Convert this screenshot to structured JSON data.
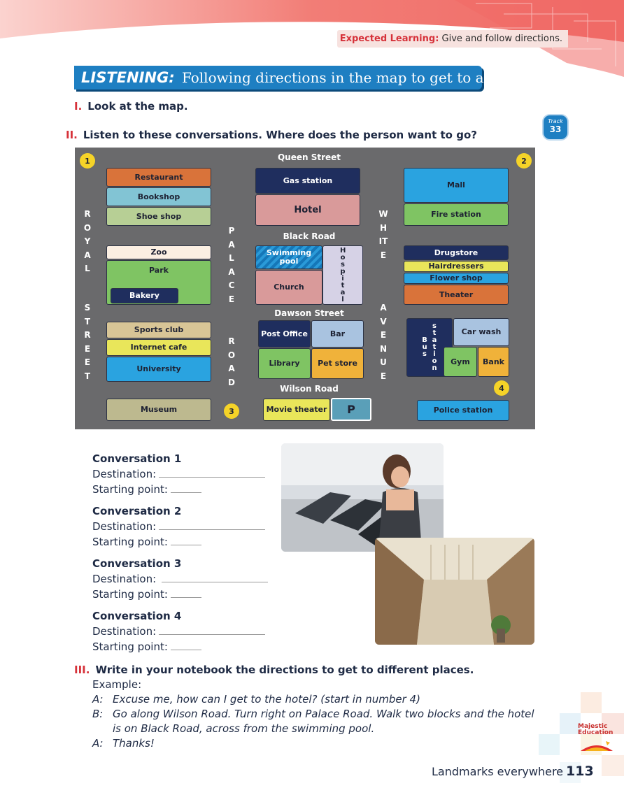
{
  "header": {
    "expected_label": "Expected Learning:",
    "expected_text": "Give and follow directions.",
    "title_keyword": "LISTENING:",
    "title_text": "Following directions in the map to get to a place"
  },
  "instructions": [
    {
      "num": "I.",
      "text": "Look at the map."
    },
    {
      "num": "II.",
      "text": "Listen to these conversations. Where does the person want to go?"
    },
    {
      "num": "III.",
      "text": "Write in your notebook the directions to get to different places."
    }
  ],
  "track": {
    "label": "Track",
    "number": "33"
  },
  "map": {
    "streets": {
      "queen": "Queen Street",
      "black": "Black Road",
      "dawson": "Dawson Street",
      "wilson": "Wilson Road",
      "royal": "ROYAL STREET",
      "royal_1": "ROYAL",
      "royal_2": "STREET",
      "palace": "PALACE ROAD",
      "palace_1": "PALACE",
      "palace_2": "ROAD",
      "white": "WHITE AVENUE",
      "white_1": "WHITE",
      "white_2": "AVENUE"
    },
    "markers": [
      "1",
      "2",
      "3",
      "4"
    ],
    "places": {
      "restaurant": "Restaurant",
      "bookshop": "Bookshop",
      "shoe_shop": "Shoe shop",
      "zoo": "Zoo",
      "park": "Park",
      "bakery": "Bakery",
      "sports_club": "Sports club",
      "internet_cafe": "Internet cafe",
      "university": "University",
      "museum": "Museum",
      "gas_station": "Gas station",
      "hotel": "Hotel",
      "swimming_pool": "Swimming pool",
      "hospital": "Hospital",
      "church": "Church",
      "post_office": "Post Office",
      "bar": "Bar",
      "library": "Library",
      "pet_store": "Pet store",
      "movie_theater": "Movie theater",
      "parking": "P",
      "mall": "Mall",
      "fire_station": "Fire station",
      "drugstore": "Drugstore",
      "hairdressers": "Hairdressers",
      "flower_shop": "Flower shop",
      "theater": "Theater",
      "bus_station": "Bus station",
      "bus_1": "Bus",
      "bus_2": "station",
      "car_wash": "Car wash",
      "gym": "Gym",
      "bank": "Bank",
      "police_station": "Police station"
    },
    "colors": {
      "navy": "#1f2e5e",
      "orange": "#d9733a",
      "lightblue": "#82c4d4",
      "sage": "#b7cf95",
      "cream": "#fbefe2",
      "green": "#7fc463",
      "tan": "#d8c596",
      "yellow": "#e9e65a",
      "skyblue": "#2aa3e0",
      "khaki": "#bdb98f",
      "pink": "#d99a9a",
      "lilac": "#d6d2e6",
      "pool": "#1a86c8",
      "paleblue": "#a9c3e0",
      "gold": "#f0b23a",
      "road": "#6a6a6c"
    }
  },
  "conversations": [
    {
      "title": "Conversation 1",
      "dest_label": "Destination:",
      "start_label": "Starting point:"
    },
    {
      "title": "Conversation 2",
      "dest_label": "Destination:",
      "start_label": "Starting point:"
    },
    {
      "title": "Conversation 3",
      "dest_label": "Destination:",
      "start_label": "Starting point:"
    },
    {
      "title": "Conversation 4",
      "dest_label": "Destination:",
      "start_label": "Starting point:"
    }
  ],
  "example": {
    "label": "Example:",
    "lines": [
      {
        "speaker": "A:",
        "text": "Excuse me, how can I get to the hotel? (start in number 4)"
      },
      {
        "speaker": "B:",
        "text": "Go along Wilson Road. Turn right on Palace Road. Walk two blocks and the hotel"
      },
      {
        "speaker": "",
        "text": "is on Black Road, across from the swimming pool."
      },
      {
        "speaker": "A:",
        "text": "Thanks!"
      }
    ]
  },
  "footer": {
    "section": "Landmarks everywhere",
    "page": "113"
  },
  "logo": {
    "text": "Majestic Education"
  }
}
